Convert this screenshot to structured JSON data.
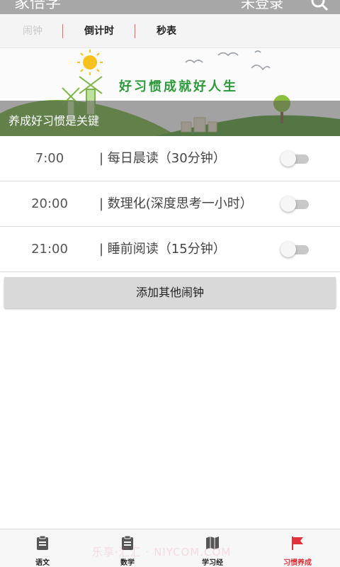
{
  "appbar": {
    "title": "家倍学",
    "login": "未登录",
    "search_icon": "search-icon"
  },
  "subtabs": [
    {
      "label": "闹钟",
      "state": "inactive"
    },
    {
      "label": "倒计时",
      "state": "normal"
    },
    {
      "label": "秒表",
      "state": "normal"
    }
  ],
  "banner": {
    "slogan": "好习惯成就好人生",
    "caption": "养成好习惯是关键"
  },
  "alarms": [
    {
      "time": "7:00",
      "label": "| 每日晨读（30分钟）",
      "enabled": false
    },
    {
      "time": "20:00",
      "label": "| 数理化(深度思考一小时）",
      "enabled": false
    },
    {
      "time": "21:00",
      "label": "| 睡前阅读（15分钟）",
      "enabled": false
    }
  ],
  "add_button": "添加其他闹钟",
  "bottom_nav": [
    {
      "label": "语文",
      "icon": "clipboard-icon",
      "active": false
    },
    {
      "label": "数学",
      "icon": "clipboard-icon",
      "active": false
    },
    {
      "label": "学习经",
      "icon": "map-icon",
      "active": false
    },
    {
      "label": "习惯养成",
      "icon": "flag-icon",
      "active": true
    }
  ],
  "colors": {
    "active": "#e0323a",
    "divider": "#e46a6a",
    "slogan": "#2c9a3a"
  },
  "watermark": "乐享·汇汇 · NIYCOM.COM"
}
